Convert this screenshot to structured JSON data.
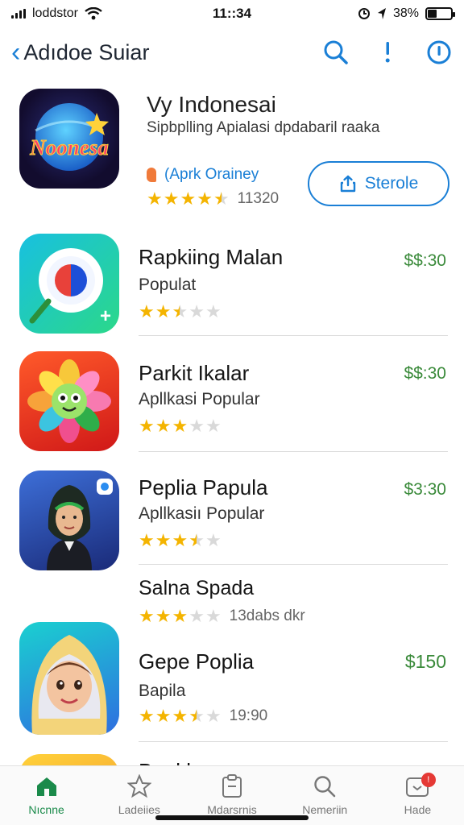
{
  "status_bar": {
    "carrier": "loddstor",
    "time": "11::34",
    "battery": "38%",
    "battery_level": 0.38
  },
  "nav": {
    "back_label": "Adıdoe Suiar"
  },
  "featured": {
    "title": "Vy Indonesai",
    "subtitle": "Sipbplling  Apialasi dpdabaril raaka",
    "icon_text": "Noonesa",
    "developer": "(Aprk Orainey",
    "rating": 4.5,
    "rating_count": "11320",
    "button_label": "Sterole"
  },
  "apps": [
    {
      "title": "Rapkiing Malan",
      "subtitle": "Populat",
      "rating": 2.5,
      "price": "$$:30"
    },
    {
      "title": "Parkit Ikalar",
      "subtitle": "Apllkasi Popular",
      "rating": 3,
      "price": "$$:30"
    },
    {
      "title": "Peplia Papula",
      "subtitle": "Apllkasiı Popular",
      "rating": 3.5,
      "price": "$3:30"
    },
    {
      "title": "Salna Spada",
      "subtitle": "",
      "rating": 3,
      "rating_count": "13dabs dkr",
      "price": ""
    },
    {
      "title": "Gepe Poplia",
      "subtitle": "Bapila",
      "rating": 3.5,
      "rating_count": "19:90",
      "price": "$150"
    },
    {
      "title": "Baukl",
      "subtitle": "",
      "rating": 0,
      "price": ""
    }
  ],
  "tabs": [
    {
      "label": "Nıcnne",
      "icon": "home-icon",
      "active": true
    },
    {
      "label": "Ladeiies",
      "icon": "star-icon",
      "active": false
    },
    {
      "label": "Mdarsrnis",
      "icon": "clipboard-icon",
      "active": false
    },
    {
      "label": "Nemeriin",
      "icon": "search-icon",
      "active": false
    },
    {
      "label": "Hade",
      "icon": "updates-icon",
      "active": false,
      "badge": "!"
    }
  ],
  "colors": {
    "accent": "#1a7fd6",
    "price": "#3a8a3a",
    "star": "#f4b400",
    "tab_active": "#1a8a4a"
  }
}
